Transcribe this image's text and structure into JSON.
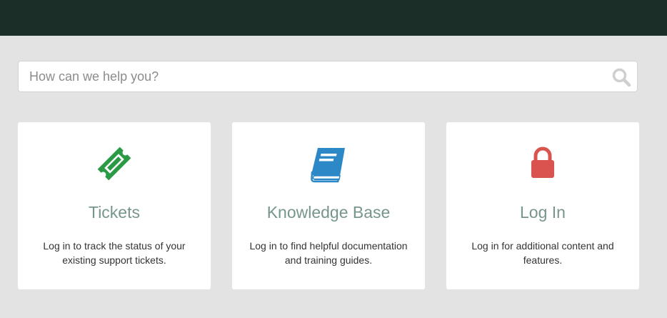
{
  "search": {
    "placeholder": "How can we help you?",
    "value": ""
  },
  "cards": [
    {
      "title": "Tickets",
      "description": "Log in to track the status of your existing support tickets.",
      "icon": "ticket-icon",
      "color": "#2b9a45"
    },
    {
      "title": "Knowledge Base",
      "description": "Log in to find helpful documentation and training guides.",
      "icon": "book-icon",
      "color": "#2d88c7"
    },
    {
      "title": "Log In",
      "description": "Log in for additional content and features.",
      "icon": "lock-icon",
      "color": "#d9534f"
    }
  ],
  "colors": {
    "header": "#1b2e27",
    "background": "#e3e3e3",
    "title": "#76968c"
  }
}
